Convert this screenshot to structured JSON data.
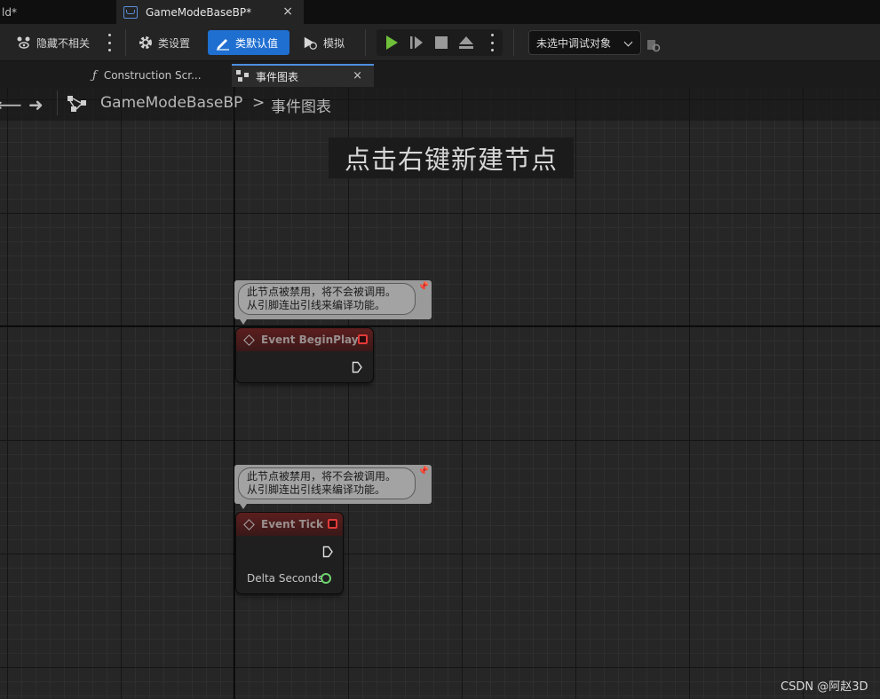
{
  "window_tabs": [
    {
      "label": "ld*"
    },
    {
      "label": "GameModeBaseBP*",
      "close": "×"
    }
  ],
  "toolbar": {
    "hide_unrelated": "隐藏不相关",
    "class_settings": "类设置",
    "class_defaults": "类默认值",
    "simulate": "模拟",
    "debug_target": "未选中调试对象"
  },
  "graph_tabs": {
    "construction": "Construction Scr...",
    "event_graph": "事件图表",
    "close": "×"
  },
  "breadcrumb": {
    "blueprint": "GameModeBaseBP",
    "separator": ">",
    "graph": "事件图表"
  },
  "canvas": {
    "hint": "点击右键新建节点"
  },
  "comments": [
    {
      "line1": "此节点被禁用，将不会被调用。",
      "line2": "从引脚连出引线来编译功能。"
    },
    {
      "line1": "此节点被禁用，将不会被调用。",
      "line2": "从引脚连出引线来编译功能。"
    }
  ],
  "nodes": [
    {
      "title": "Event BeginPlay"
    },
    {
      "title": "Event Tick",
      "pin_label": "Delta Seconds"
    }
  ],
  "colors": {
    "accent": "#1f6fd1",
    "play": "#6fbf3a",
    "event_header": "#5c1e1e",
    "delegate_pin": "#e23a3a",
    "float_pin": "#6fd46f"
  },
  "watermark": "CSDN @阿赵3D"
}
